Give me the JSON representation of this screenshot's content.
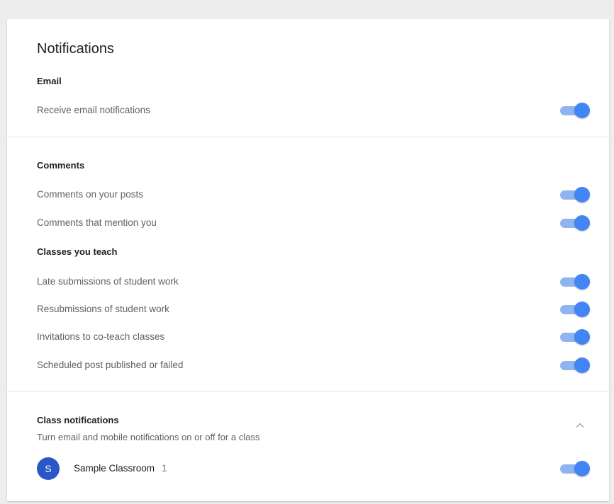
{
  "page": {
    "title": "Notifications"
  },
  "email": {
    "heading": "Email",
    "items": [
      {
        "label": "Receive email notifications",
        "enabled": true
      }
    ]
  },
  "comments": {
    "heading": "Comments",
    "items": [
      {
        "label": "Comments on your posts",
        "enabled": true
      },
      {
        "label": "Comments that mention you",
        "enabled": true
      }
    ]
  },
  "teach": {
    "heading": "Classes you teach",
    "items": [
      {
        "label": "Late submissions of student work",
        "enabled": true
      },
      {
        "label": "Resubmissions of student work",
        "enabled": true
      },
      {
        "label": "Invitations to co-teach classes",
        "enabled": true
      },
      {
        "label": "Scheduled post published or failed",
        "enabled": true
      }
    ]
  },
  "class_notifications": {
    "heading": "Class notifications",
    "subtitle": "Turn email and mobile notifications on or off for a class",
    "collapse_icon": "chevron-up-icon",
    "classes": [
      {
        "avatar_letter": "S",
        "name": "Sample Classroom",
        "count": "1",
        "enabled": true
      }
    ]
  },
  "colors": {
    "toggle_thumb": "#4285f4",
    "toggle_track": "#8fb4f0",
    "avatar": "#2a56c6"
  }
}
